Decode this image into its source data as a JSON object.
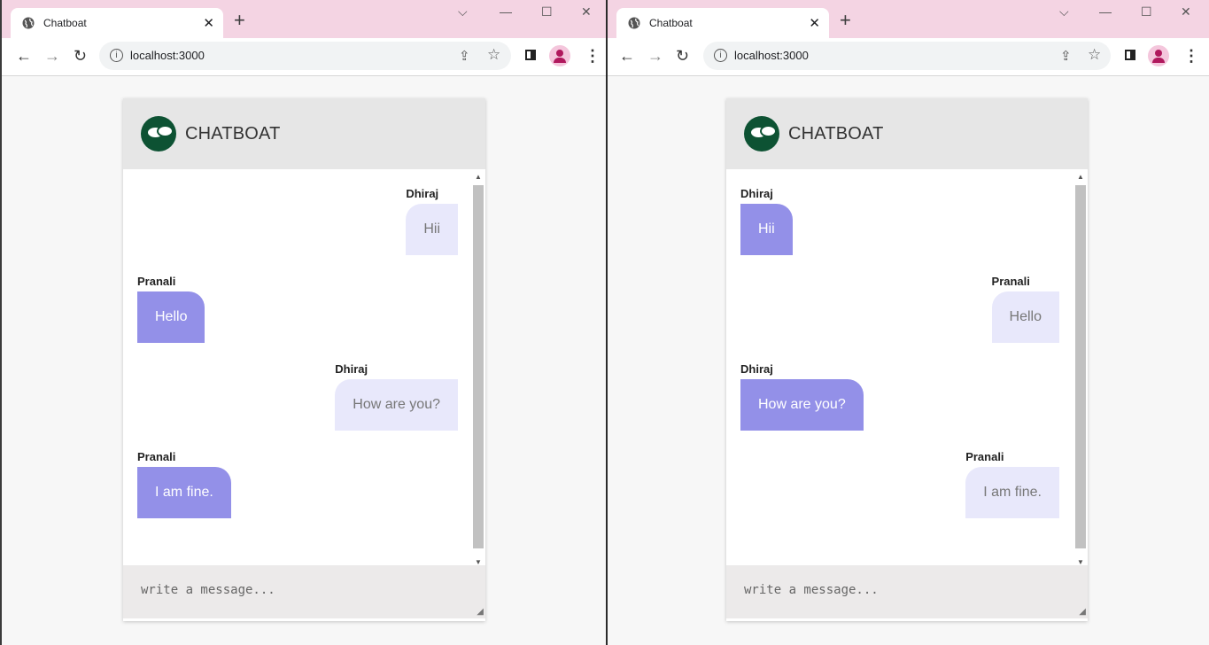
{
  "left": {
    "tab_title": "Chatboat",
    "url": "localhost:3000",
    "chat_title": "CHATBOAT",
    "placeholder": "write a message...",
    "messages": [
      {
        "sender": "Dhiraj",
        "text": "Hii",
        "align": "right"
      },
      {
        "sender": "Pranali",
        "text": "Hello",
        "align": "left"
      },
      {
        "sender": "Dhiraj",
        "text": "How are you?",
        "align": "right"
      },
      {
        "sender": "Pranali",
        "text": "I am fine.",
        "align": "left"
      }
    ]
  },
  "right": {
    "tab_title": "Chatboat",
    "url": "localhost:3000",
    "chat_title": "CHATBOAT",
    "placeholder": "write a message...",
    "messages": [
      {
        "sender": "Dhiraj",
        "text": "Hii",
        "align": "left"
      },
      {
        "sender": "Pranali",
        "text": "Hello",
        "align": "right"
      },
      {
        "sender": "Dhiraj",
        "text": "How are you?",
        "align": "left"
      },
      {
        "sender": "Pranali",
        "text": "I am fine.",
        "align": "right"
      }
    ]
  },
  "colors": {
    "own_bubble": "#e8e8fb",
    "other_bubble": "#9390e8",
    "logo": "#0d5233",
    "titlebar": "#f4d4e3"
  },
  "icons": {
    "tab": "globe-icon",
    "logo": "chat-bubbles-icon"
  }
}
